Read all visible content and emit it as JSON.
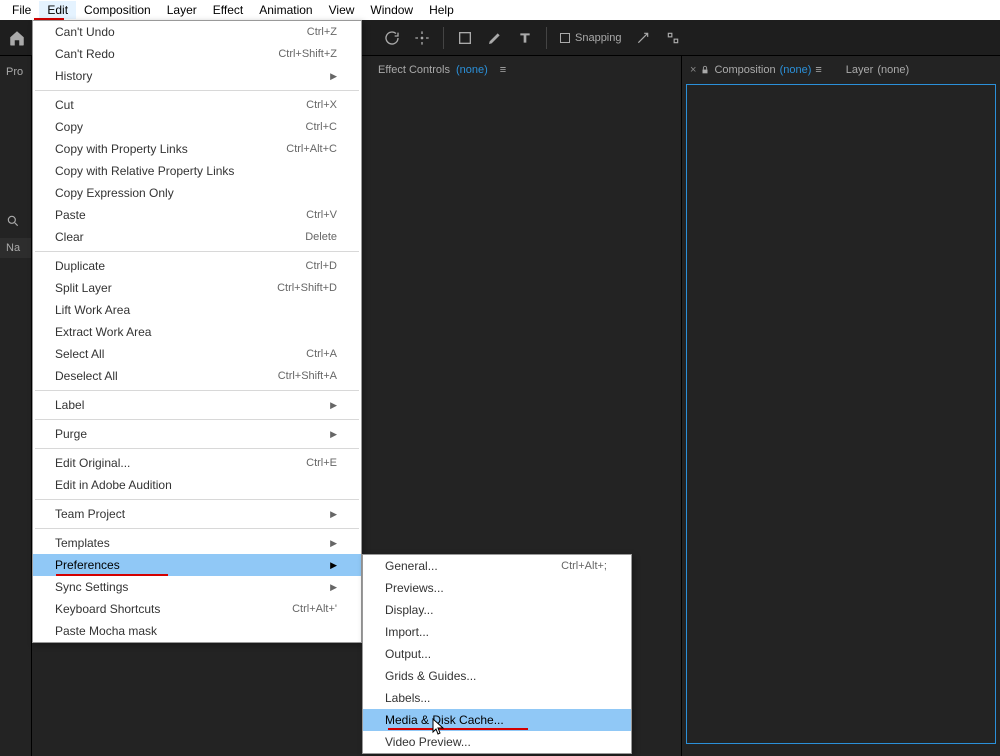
{
  "menubar": {
    "items": [
      "File",
      "Edit",
      "Composition",
      "Layer",
      "Effect",
      "Animation",
      "View",
      "Window",
      "Help"
    ]
  },
  "toolbar": {
    "snapping_label": "Snapping"
  },
  "panels": {
    "project_label": "Pro",
    "name_col": "Na",
    "effect_controls": {
      "label": "Effect Controls",
      "value": "(none)"
    },
    "composition": {
      "label": "Composition",
      "value": "(none)"
    },
    "layer": {
      "label": "Layer",
      "value": "(none)"
    }
  },
  "edit_menu": {
    "items": [
      {
        "label": "Can't Undo",
        "sc": "Ctrl+Z"
      },
      {
        "label": "Can't Redo",
        "sc": "Ctrl+Shift+Z"
      },
      {
        "label": "History",
        "arrow": true
      },
      {
        "sep": true
      },
      {
        "label": "Cut",
        "sc": "Ctrl+X"
      },
      {
        "label": "Copy",
        "sc": "Ctrl+C"
      },
      {
        "label": "Copy with Property Links",
        "sc": "Ctrl+Alt+C"
      },
      {
        "label": "Copy with Relative Property Links"
      },
      {
        "label": "Copy Expression Only"
      },
      {
        "label": "Paste",
        "sc": "Ctrl+V"
      },
      {
        "label": "Clear",
        "sc": "Delete"
      },
      {
        "sep": true
      },
      {
        "label": "Duplicate",
        "sc": "Ctrl+D"
      },
      {
        "label": "Split Layer",
        "sc": "Ctrl+Shift+D"
      },
      {
        "label": "Lift Work Area"
      },
      {
        "label": "Extract Work Area"
      },
      {
        "label": "Select All",
        "sc": "Ctrl+A"
      },
      {
        "label": "Deselect All",
        "sc": "Ctrl+Shift+A"
      },
      {
        "sep": true
      },
      {
        "label": "Label",
        "arrow": true
      },
      {
        "sep": true
      },
      {
        "label": "Purge",
        "arrow": true
      },
      {
        "sep": true
      },
      {
        "label": "Edit Original...",
        "sc": "Ctrl+E"
      },
      {
        "label": "Edit in Adobe Audition"
      },
      {
        "sep": true
      },
      {
        "label": "Team Project",
        "arrow": true
      },
      {
        "sep": true
      },
      {
        "label": "Templates",
        "arrow": true
      },
      {
        "label": "Preferences",
        "arrow": true,
        "hl": true
      },
      {
        "label": "Sync Settings",
        "arrow": true
      },
      {
        "label": "Keyboard Shortcuts",
        "sc": "Ctrl+Alt+'"
      },
      {
        "label": "Paste Mocha mask"
      }
    ]
  },
  "prefs_menu": {
    "items": [
      {
        "label": "General...",
        "sc": "Ctrl+Alt+;"
      },
      {
        "label": "Previews..."
      },
      {
        "label": "Display..."
      },
      {
        "label": "Import..."
      },
      {
        "label": "Output..."
      },
      {
        "label": "Grids & Guides..."
      },
      {
        "label": "Labels..."
      },
      {
        "label": "Media & Disk Cache...",
        "hl": true
      },
      {
        "label": "Video Preview..."
      }
    ]
  }
}
